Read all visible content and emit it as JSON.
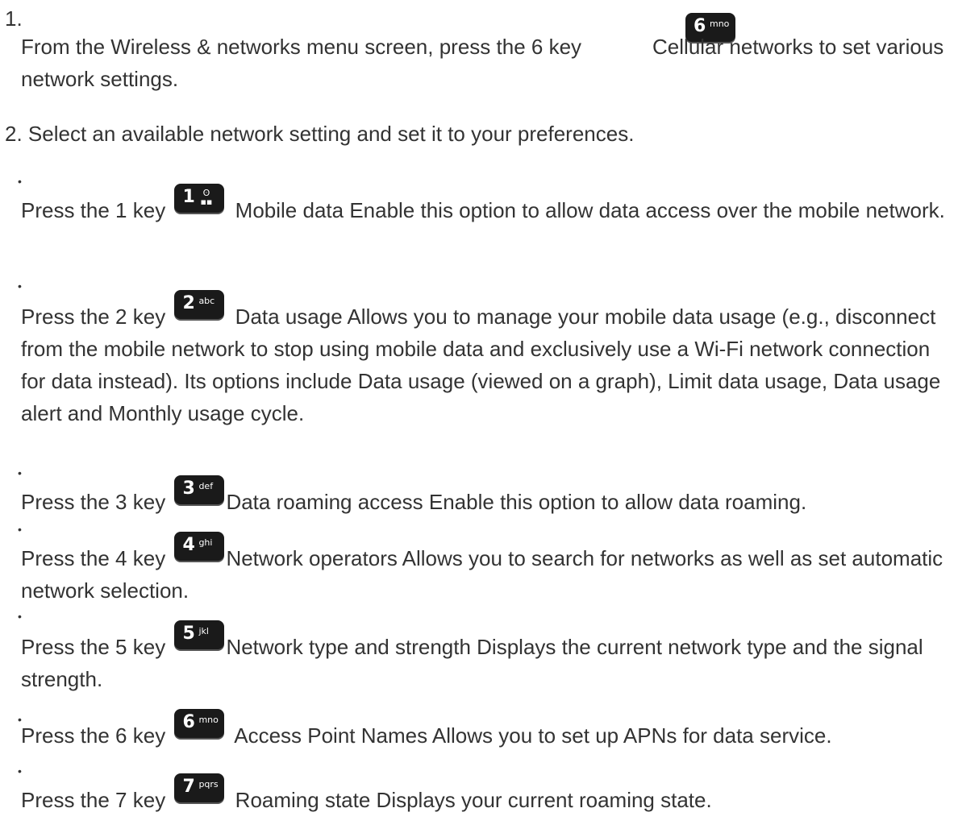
{
  "step1": {
    "number": "1.",
    "text_before_key": "From the Wireless & networks menu screen, press the 6 key",
    "key": {
      "digit": "6",
      "letters": "mno",
      "icon": "6-mno-key-icon"
    },
    "text_after_key": "Cellular networks to set various network settings."
  },
  "step2": {
    "text": "2. Select an available network setting and set it to your preferences."
  },
  "bullets": [
    {
      "bullet": "•",
      "prefix": "Press the 1 key",
      "key": {
        "digit": "1",
        "letters": "",
        "icon": "1-voicemail-key-icon"
      },
      "text": "Mobile data Enable this option to allow data access over the mobile network."
    },
    {
      "bullet": "•",
      "prefix": "Press the 2 key",
      "key": {
        "digit": "2",
        "letters": "abc",
        "icon": "2-abc-key-icon"
      },
      "text": "Data usage Allows you to manage your mobile data usage (e.g., disconnect from the mobile network to stop using mobile data and exclusively use a Wi-Fi network connection for data instead). Its options include Data usage (viewed on a graph), Limit data usage, Data usage alert and Monthly usage cycle."
    },
    {
      "bullet": "•",
      "prefix": "Press the 3 key",
      "key": {
        "digit": "3",
        "letters": "def",
        "icon": "3-def-key-icon"
      },
      "text": "Data roaming access Enable this option to allow data roaming."
    },
    {
      "bullet": "•",
      "prefix": "Press the 4 key",
      "key": {
        "digit": "4",
        "letters": "ghi",
        "icon": "4-ghi-key-icon"
      },
      "text": "Network operators Allows you to search for networks as well as set automatic network selection."
    },
    {
      "bullet": "•",
      "prefix": "Press the 5 key",
      "key": {
        "digit": "5",
        "letters": "jkl",
        "icon": "5-jkl-key-icon"
      },
      "text": "Network type and strength Displays the current network type and the signal strength."
    },
    {
      "bullet": "•",
      "prefix": "Press the 6 key",
      "key": {
        "digit": "6",
        "letters": "mno",
        "icon": "6-mno-key-icon"
      },
      "text": "Access Point Names Allows you to set up APNs for data service."
    },
    {
      "bullet": "•",
      "prefix": "Press the 7 key",
      "key": {
        "digit": "7",
        "letters": "pqrs",
        "icon": "7-pqrs-key-icon"
      },
      "text": "Roaming state Displays your current roaming state."
    }
  ]
}
